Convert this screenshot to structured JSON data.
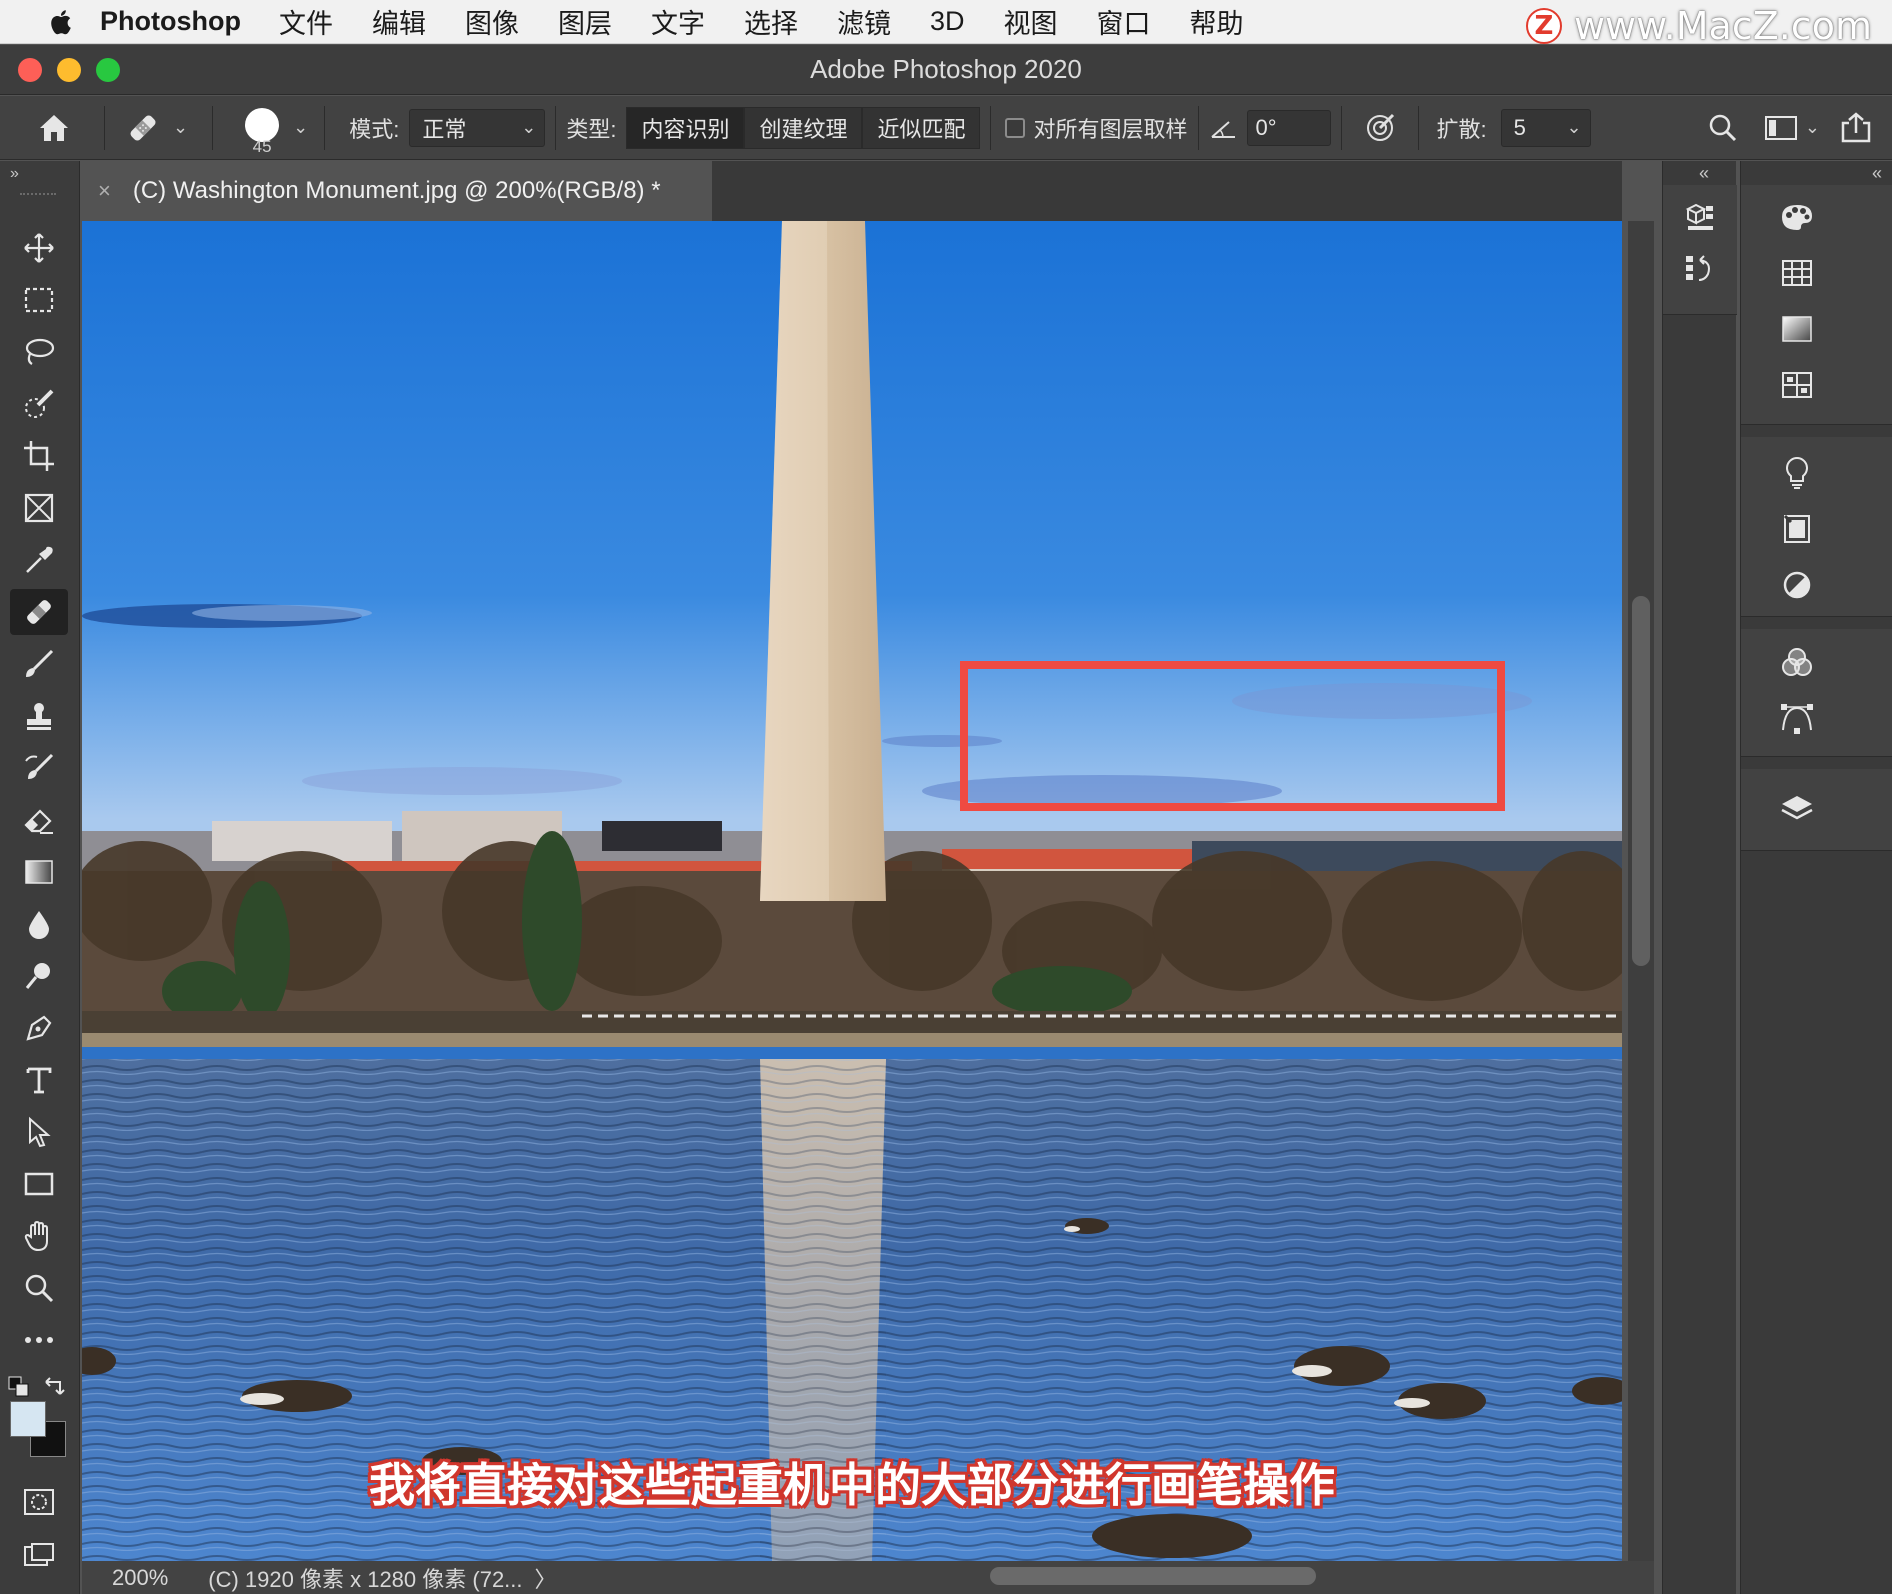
{
  "menubar": {
    "app": "Photoshop",
    "items": [
      "文件",
      "编辑",
      "图像",
      "图层",
      "文字",
      "选择",
      "滤镜",
      "3D",
      "视图",
      "窗口",
      "帮助"
    ],
    "watermark": "www.MacZ.com",
    "watermark_logo": "Z"
  },
  "window": {
    "title": "Adobe Photoshop 2020"
  },
  "options": {
    "brush_size": "45",
    "mode_label": "模式:",
    "mode_value": "正常",
    "type_label": "类型:",
    "type_options": [
      "内容识别",
      "创建纹理",
      "近似匹配"
    ],
    "sample_all_label": "对所有图层取样",
    "angle_value": "0°",
    "diffusion_label": "扩散:",
    "diffusion_value": "5"
  },
  "document": {
    "tab_title": "(C) Washington Monument.jpg @ 200%(RGB/8) *"
  },
  "canvas": {
    "subtitle": "我将直接对这些起重机中的大部分进行画笔操作"
  },
  "status": {
    "zoom": "200%",
    "info": "(C) 1920 像素 x 1280 像素 (72...",
    "arrow": "〉"
  },
  "colors": {
    "highlight_box": "#ef4a42",
    "foreground": "#d6e6f2",
    "background": "#111111"
  },
  "tools": [
    "move-icon",
    "marquee-icon",
    "lasso-icon",
    "quick-select-icon",
    "crop-icon",
    "frame-icon",
    "eyedropper-icon",
    "healing-brush-icon",
    "brush-icon",
    "clone-stamp-icon",
    "history-brush-icon",
    "eraser-icon",
    "gradient-icon",
    "blur-icon",
    "dodge-icon",
    "pen-icon",
    "type-icon",
    "path-select-icon",
    "rectangle-icon",
    "hand-icon",
    "zoom-icon",
    "more-icon"
  ]
}
